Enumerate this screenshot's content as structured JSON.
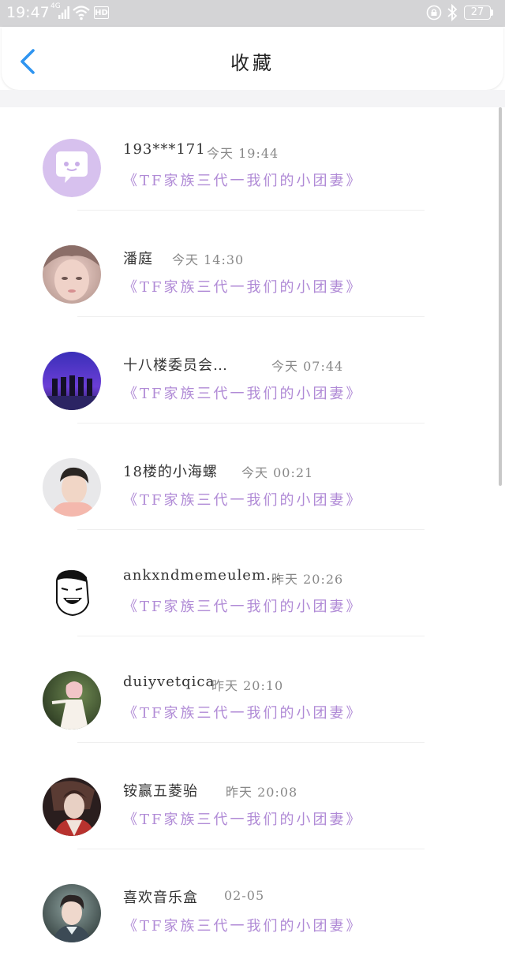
{
  "status_bar": {
    "time": "19:47",
    "network": "4G",
    "hd": "HD",
    "battery": "27"
  },
  "header": {
    "title": "收藏",
    "back_icon": "chevron-left-icon"
  },
  "colors": {
    "accent": "#2f95f0",
    "message_purple": "#b08ad6",
    "status_bar_bg": "#d4d4d6"
  },
  "favorites": [
    {
      "name": "193***171",
      "time": "今天 19:44",
      "message": "《TF家族三代一我们的小团妻》"
    },
    {
      "name": "潘庭",
      "time": "今天 14:30",
      "message": "《TF家族三代一我们的小团妻》"
    },
    {
      "name": "十八楼委员会…",
      "time": "今天 07:44",
      "message": "《TF家族三代一我们的小团妻》"
    },
    {
      "name": "18楼的小海螺",
      "time": "今天 00:21",
      "message": "《TF家族三代一我们的小团妻》"
    },
    {
      "name": "ankxndmemeulem…",
      "time": "昨天 20:26",
      "message": "《TF家族三代一我们的小团妻》"
    },
    {
      "name": "duiyvetqica",
      "time": "昨天 20:10",
      "message": "《TF家族三代一我们的小团妻》"
    },
    {
      "name": "铵赢五菱骀",
      "time": "昨天 20:08",
      "message": "《TF家族三代一我们的小团妻》"
    },
    {
      "name": "喜欢音乐盒",
      "time": "02-05",
      "message": "《TF家族三代一我们的小团妻》"
    }
  ]
}
